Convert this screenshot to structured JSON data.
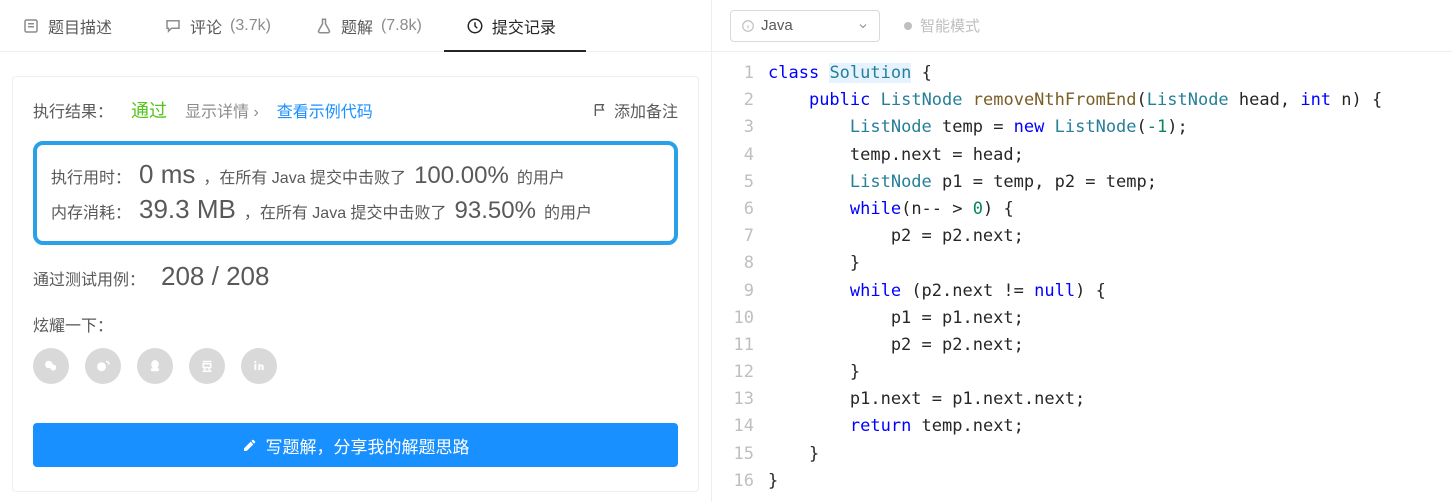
{
  "tabs": [
    {
      "label": "题目描述",
      "count": ""
    },
    {
      "label": "评论",
      "count": "(3.7k)"
    },
    {
      "label": "题解",
      "count": "(7.8k)"
    },
    {
      "label": "提交记录",
      "count": ""
    }
  ],
  "result": {
    "label": "执行结果：",
    "status": "通过",
    "details_link": "显示详情 ›",
    "sample_link": "查看示例代码",
    "add_note": "添加备注",
    "runtime_label": "执行用时：",
    "runtime_value": "0 ms",
    "runtime_desc_prefix": "，在所有 Java 提交中击败了",
    "runtime_pct": "100.00%",
    "runtime_desc_suffix": "的用户",
    "memory_label": "内存消耗：",
    "memory_value": "39.3 MB",
    "memory_desc_prefix": "，在所有 Java 提交中击败了",
    "memory_pct": "93.50%",
    "memory_desc_suffix": "的用户",
    "testcases_label": "通过测试用例：",
    "testcases_value": "208 / 208",
    "share_label": "炫耀一下：",
    "write_button": "写题解，分享我的解题思路"
  },
  "editor": {
    "language": "Java",
    "mode_label": "智能模式"
  },
  "code_raw": "class Solution {\n    public ListNode removeNthFromEnd(ListNode head, int n) {\n        ListNode temp = new ListNode(-1);\n        temp.next = head;\n        ListNode p1 = temp, p2 = temp;\n        while(n-- > 0) {\n            p2 = p2.next;\n        }\n        while (p2.next != null) {\n            p1 = p1.next;\n            p2 = p2.next;\n        }\n        p1.next = p1.next.next;\n        return temp.next;\n    }\n}",
  "code_lines": [
    [
      [
        "kw",
        "class"
      ],
      [
        "op",
        " "
      ],
      [
        "type hl",
        "Solution"
      ],
      [
        "op",
        " {"
      ]
    ],
    [
      [
        "op",
        "    "
      ],
      [
        "kw",
        "public"
      ],
      [
        "op",
        " "
      ],
      [
        "type",
        "ListNode"
      ],
      [
        "op",
        " "
      ],
      [
        "fn",
        "removeNthFromEnd"
      ],
      [
        "op",
        "("
      ],
      [
        "type",
        "ListNode"
      ],
      [
        "op",
        " head, "
      ],
      [
        "kw",
        "int"
      ],
      [
        "op",
        " n) {"
      ]
    ],
    [
      [
        "op",
        "        "
      ],
      [
        "type",
        "ListNode"
      ],
      [
        "op",
        " temp = "
      ],
      [
        "kw",
        "new"
      ],
      [
        "op",
        " "
      ],
      [
        "type",
        "ListNode"
      ],
      [
        "op",
        "("
      ],
      [
        "num",
        "-1"
      ],
      [
        "op",
        ");"
      ]
    ],
    [
      [
        "op",
        "        temp.next = head;"
      ]
    ],
    [
      [
        "op",
        "        "
      ],
      [
        "type",
        "ListNode"
      ],
      [
        "op",
        " p1 = temp, p2 = temp;"
      ]
    ],
    [
      [
        "op",
        "        "
      ],
      [
        "kw",
        "while"
      ],
      [
        "op",
        "(n-- > "
      ],
      [
        "num",
        "0"
      ],
      [
        "op",
        ") {"
      ]
    ],
    [
      [
        "op",
        "            p2 = p2.next;"
      ]
    ],
    [
      [
        "op",
        "        }"
      ]
    ],
    [
      [
        "op",
        "        "
      ],
      [
        "kw",
        "while"
      ],
      [
        "op",
        " (p2.next != "
      ],
      [
        "kw",
        "null"
      ],
      [
        "op",
        ") {"
      ]
    ],
    [
      [
        "op",
        "            p1 = p1.next;"
      ]
    ],
    [
      [
        "op",
        "            p2 = p2.next;"
      ]
    ],
    [
      [
        "op",
        "        }"
      ]
    ],
    [
      [
        "op",
        "        p1.next = p1.next.next;"
      ]
    ],
    [
      [
        "op",
        "        "
      ],
      [
        "kw",
        "return"
      ],
      [
        "op",
        " temp.next;"
      ]
    ],
    [
      [
        "op",
        "    }"
      ]
    ],
    [
      [
        "op",
        "}"
      ]
    ]
  ]
}
